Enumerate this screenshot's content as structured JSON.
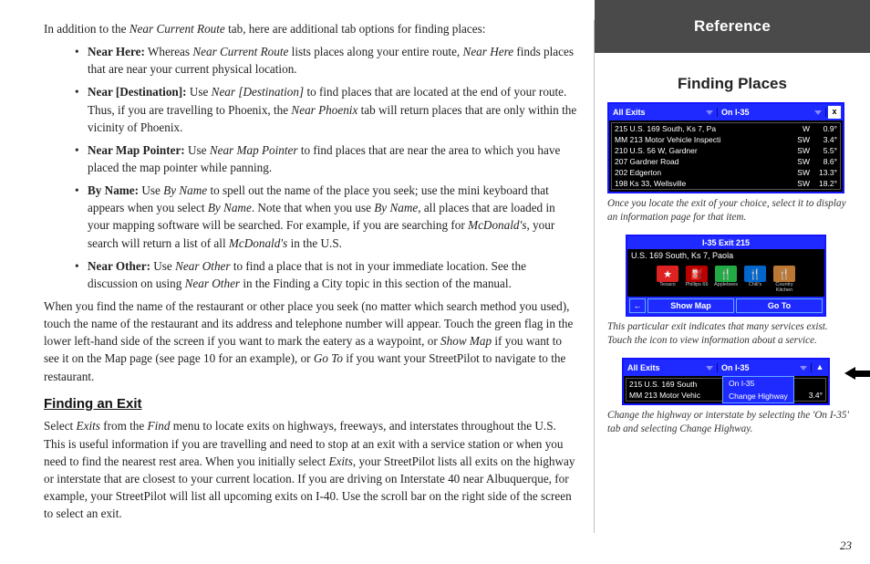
{
  "main": {
    "intro": "In addition to the Near Current Route tab, here are additional tab options for finding places:",
    "introItalic": "Near Current Route",
    "bullets": [
      {
        "head": "Near Here:",
        "body": " Whereas ",
        "i1": "Near Current Route",
        "body2": " lists places along your entire route, ",
        "i2": "Near Here",
        "body3": " finds places that are near your current physical location."
      },
      {
        "head": "Near [Destination]:",
        "body": " Use ",
        "i1": "Near [Destination]",
        "body2": " to find places that are located at the end of your route. Thus, if you are travelling to Phoenix, the ",
        "i2": "Near Phoenix",
        "body3": " tab will return places that are only within the vicinity of Phoenix."
      },
      {
        "head": "Near Map Pointer:",
        "body": " Use ",
        "i1": "Near Map Pointer",
        "body2": " to find places that are near the area to which you have placed the map pointer while panning.",
        "i2": "",
        "body3": ""
      },
      {
        "head": "By Name:",
        "body": " Use ",
        "i1": "By Name",
        "body2": " to spell out the name of the place you seek; use the mini keyboard that appears when you select ",
        "i2": "By Name",
        "body3": ". Note that when you use ",
        "i3": "By Name",
        "body4": ", all places that are loaded in your mapping software will be searched. For example, if you are searching for ",
        "i4": "McDonald's",
        "body5": ", your search will return a list of all ",
        "i5": "McDonald's",
        "body6": " in the U.S."
      },
      {
        "head": "Near Other:",
        "body": " Use ",
        "i1": "Near Other",
        "body2": " to find a place that is not in your immediate location. See the discussion on using ",
        "i2": "Near Other",
        "body3": " in the Finding a City topic in this section of the manual."
      }
    ],
    "para2a": "When you find the name of the restaurant or other place you seek (no matter which search method you used), touch the name of the restaurant and its address and telephone number will appear. Touch the green flag in the lower left-hand side of the screen if you want to mark the eatery as a waypoint, or ",
    "para2i1": "Show Map",
    "para2b": " if you want to see it on the Map page (see page 10 for an example), or ",
    "para2i2": "Go To",
    "para2c": " if you want your StreetPilot to navigate to the restaurant.",
    "h2": "Finding an Exit",
    "para3a": "Select ",
    "para3i1": "Exits",
    "para3b": " from the ",
    "para3i2": "Find",
    "para3c": " menu to locate exits on highways, freeways, and interstates throughout the U.S. This is useful information if you are travelling and need to stop at an exit with a service station or when you need to find the nearest rest area. When you initially select ",
    "para3i3": "Exits",
    "para3d": ", your StreetPilot lists all exits on the highway or interstate that are closest to your current location. If you are driving on Interstate 40 near Albuquerque, for example, your StreetPilot will list all upcoming exits on I-40. Use the scroll bar on the right side of the screen to select an exit."
  },
  "side": {
    "banner": "Reference",
    "title": "Finding Places",
    "dev1": {
      "dd1": "All Exits",
      "dd2": "On I-35",
      "close": "x",
      "rows": [
        {
          "a": "215 U.S. 169 South, Ks 7, Pa",
          "b": "W",
          "c": "0.9°"
        },
        {
          "a": "MM 213 Motor Vehicle Inspecti",
          "b": "SW",
          "c": "3.4°"
        },
        {
          "a": "210 U.S. 56 W, Gardner",
          "b": "SW",
          "c": "5.5°"
        },
        {
          "a": "207 Gardner Road",
          "b": "SW",
          "c": "8.6°"
        },
        {
          "a": "202 Edgerton",
          "b": "SW",
          "c": "13.3°"
        },
        {
          "a": "198 Ks 33, Wellsville",
          "b": "SW",
          "c": "18.2°"
        }
      ]
    },
    "cap1": "Once you locate the exit of your choice, select it to display an information page for that item.",
    "dev2": {
      "title": "I-35 Exit 215",
      "sub": "U.S. 169 South, Ks 7, Paola",
      "icons": [
        {
          "label": "Texaco",
          "bg": "#d22",
          "sym": "★"
        },
        {
          "label": "Phillips 66",
          "bg": "#b00",
          "sym": "⛽"
        },
        {
          "label": "Applebees",
          "bg": "#2a4",
          "sym": "🍴"
        },
        {
          "label": "Chili's",
          "bg": "#06c",
          "sym": "🍴"
        },
        {
          "label": "Country Kitchen",
          "bg": "#b73",
          "sym": "🍴"
        }
      ],
      "back": "←",
      "show": "Show Map",
      "goto": "Go To"
    },
    "cap2": "This particular exit indicates that many services exist. Touch the icon to view information about a service.",
    "dev3": {
      "dd1": "All Exits",
      "dd2": "On I-35",
      "up": "▲",
      "rows": [
        {
          "a": "215 U.S. 169 South",
          "b": "",
          "c": ""
        },
        {
          "a": "MM 213 Motor Vehic",
          "b": "",
          "c": "3.4°"
        }
      ],
      "menu": [
        "On I-35",
        "Change Highway"
      ]
    },
    "cap3": "Change the highway or interstate by selecting the 'On I-35' tab and selecting Change Highway."
  },
  "pageNum": "23"
}
